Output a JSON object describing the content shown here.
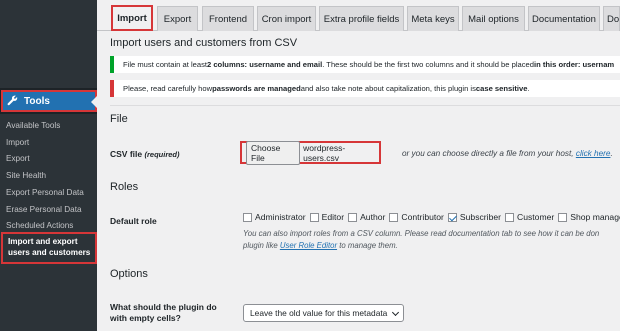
{
  "sidebar": {
    "tools_label": "Tools",
    "items": [
      "Available Tools",
      "Import",
      "Export",
      "Site Health",
      "Export Personal Data",
      "Erase Personal Data",
      "Scheduled Actions"
    ],
    "active_line1": "Import and export",
    "active_line2": "users and customers"
  },
  "tabs": [
    "Import",
    "Export",
    "Frontend",
    "Cron import",
    "Extra profile fields",
    "Meta keys",
    "Mail options",
    "Documentation",
    "Do"
  ],
  "header": {
    "title": "Import users and customers from CSV"
  },
  "notices": {
    "green": {
      "a": "File must contain at least ",
      "b": "2 columns: username and email",
      "c": ". These should be the first two columns and it should be placed ",
      "d": "in this order: usernam"
    },
    "red": {
      "a": "Please, read carefully how ",
      "b": "passwords are managed",
      "c": " and also take note about capitalization, this plugin is ",
      "d": "case sensitive",
      "e": "."
    }
  },
  "file_section": {
    "title": "File",
    "csv_label": "CSV file",
    "csv_required": "(required)",
    "choose_button": "Choose File",
    "file_name": "wordpress-users.csv",
    "or_text": "or you can choose directly a file from your host,",
    "click_here": "click here",
    "period": "."
  },
  "roles_section": {
    "title": "Roles",
    "default_role_label": "Default role",
    "roles": [
      {
        "label": "Administrator",
        "checked": false
      },
      {
        "label": "Editor",
        "checked": false
      },
      {
        "label": "Author",
        "checked": false
      },
      {
        "label": "Contributor",
        "checked": false
      },
      {
        "label": "Subscriber",
        "checked": true
      },
      {
        "label": "Customer",
        "checked": false
      },
      {
        "label": "Shop manager",
        "checked": false
      }
    ],
    "desc1": "You can also import roles from a CSV column. Please read documentation tab to see how it can be don",
    "desc2a": "plugin like ",
    "desc2_link": "User Role Editor",
    "desc2b": " to manage them."
  },
  "options_section": {
    "title": "Options",
    "empty_label1": "What should the plugin do",
    "empty_label2": "with empty cells?",
    "empty_select": "Leave the old value for this metadata"
  },
  "colors": {
    "accent": "#2271b1",
    "highlight": "#d63638",
    "success": "#00a32a",
    "sidebar": "#1d2327"
  }
}
